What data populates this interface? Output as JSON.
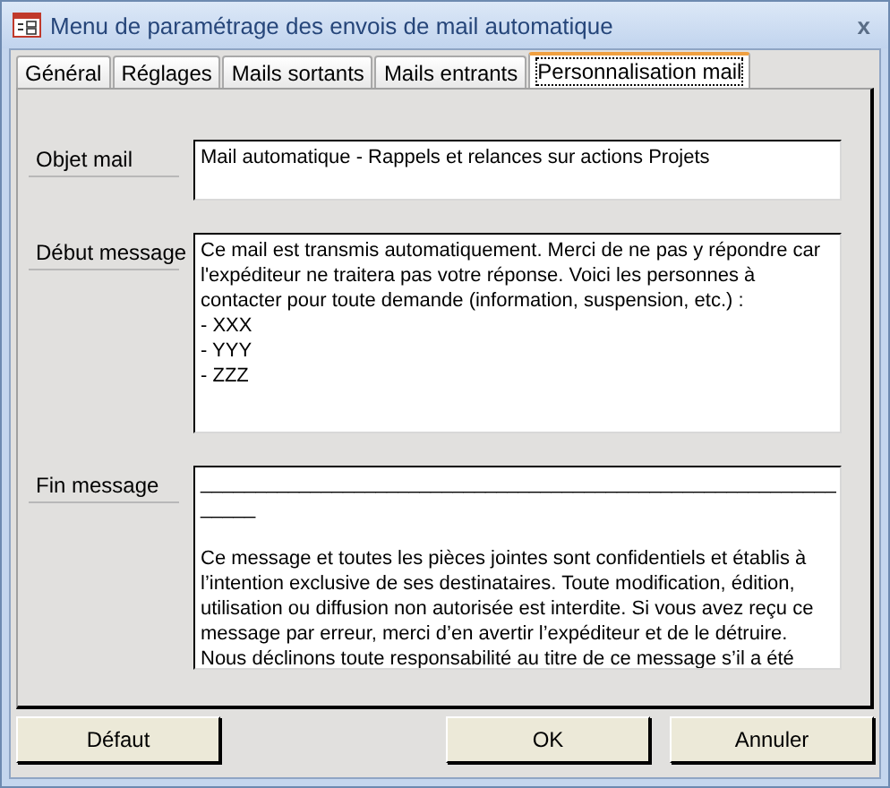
{
  "window": {
    "title": "Menu de paramétrage des envois de mail automatique",
    "close": "x"
  },
  "tabs": [
    {
      "label": "Général",
      "selected": false
    },
    {
      "label": "Réglages",
      "selected": false
    },
    {
      "label": "Mails sortants",
      "selected": false
    },
    {
      "label": "Mails entrants",
      "selected": false
    },
    {
      "label": "Personnalisation mail",
      "selected": true
    }
  ],
  "fields": [
    {
      "label": "Objet mail",
      "paragraphs": [
        [
          "Mail automatique - Rappels et relances sur actions Projets"
        ]
      ]
    },
    {
      "label": "Début message",
      "paragraphs": [
        [
          "Ce mail est transmis automatiquement. Merci de ne pas y répondre car",
          "l'expéditeur ne traitera pas votre réponse. Voici les personnes à",
          "contacter pour toute demande (information, suspension, etc.) :",
          "- XXX",
          "- YYY",
          "- ZZZ"
        ]
      ]
    },
    {
      "label": "Fin message",
      "paragraphs": [
        [
          "__________________________________________________________",
          "_____"
        ],
        [
          "Ce message et toutes les pièces jointes sont confidentiels et établis à",
          "l’intention exclusive de ses destinataires. Toute modification, édition,",
          "utilisation ou diffusion non autorisée est interdite. Si vous avez reçu ce",
          "message par erreur, merci d’en avertir l’expéditeur et de le détruire.",
          "Nous déclinons toute responsabilité au titre de ce message s’il a été"
        ]
      ]
    }
  ],
  "buttons": [
    {
      "label": "Défaut"
    },
    {
      "label": "OK"
    },
    {
      "label": "Annuler"
    }
  ]
}
